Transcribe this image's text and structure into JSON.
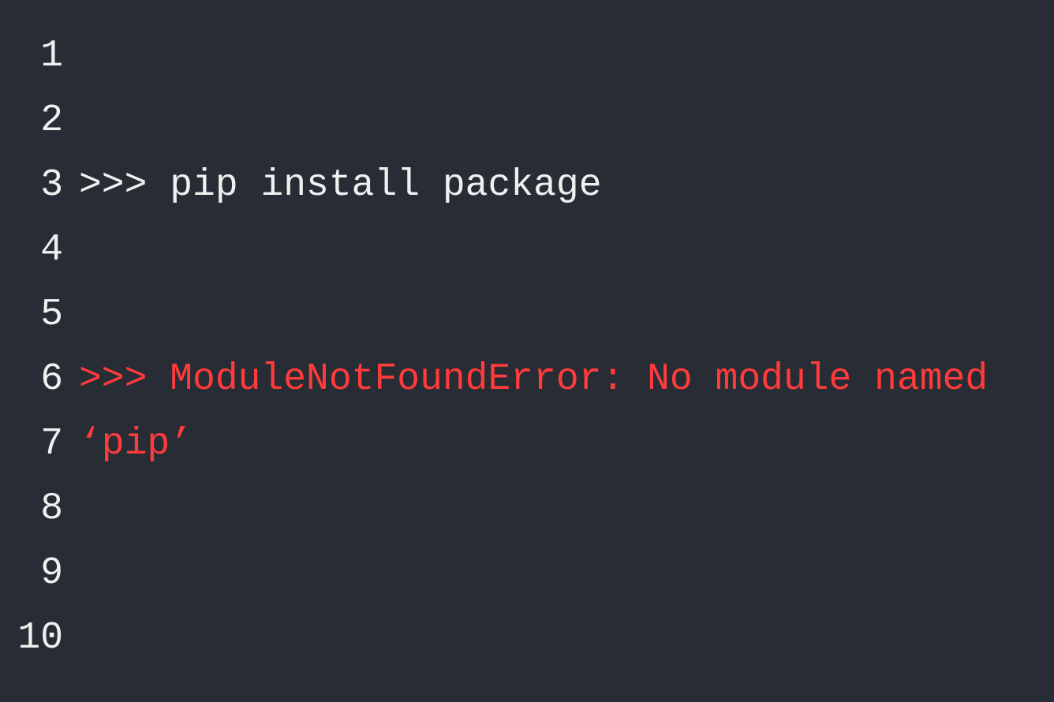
{
  "editor": {
    "background": "#282c34",
    "foreground": "#f0f0f0",
    "errorColor": "#ff3b3b",
    "lineNumbers": [
      "1",
      "2",
      "3",
      "4",
      "5",
      "6",
      "7",
      "8",
      "9",
      "10"
    ],
    "lines": {
      "l1": "",
      "l2": "",
      "l3": ">>> pip install package",
      "l4": "",
      "l5": "",
      "l6_7": ">>> ModuleNotFoundError: No module named ‘pip’",
      "l8": "",
      "l9": "",
      "l10": ""
    }
  }
}
